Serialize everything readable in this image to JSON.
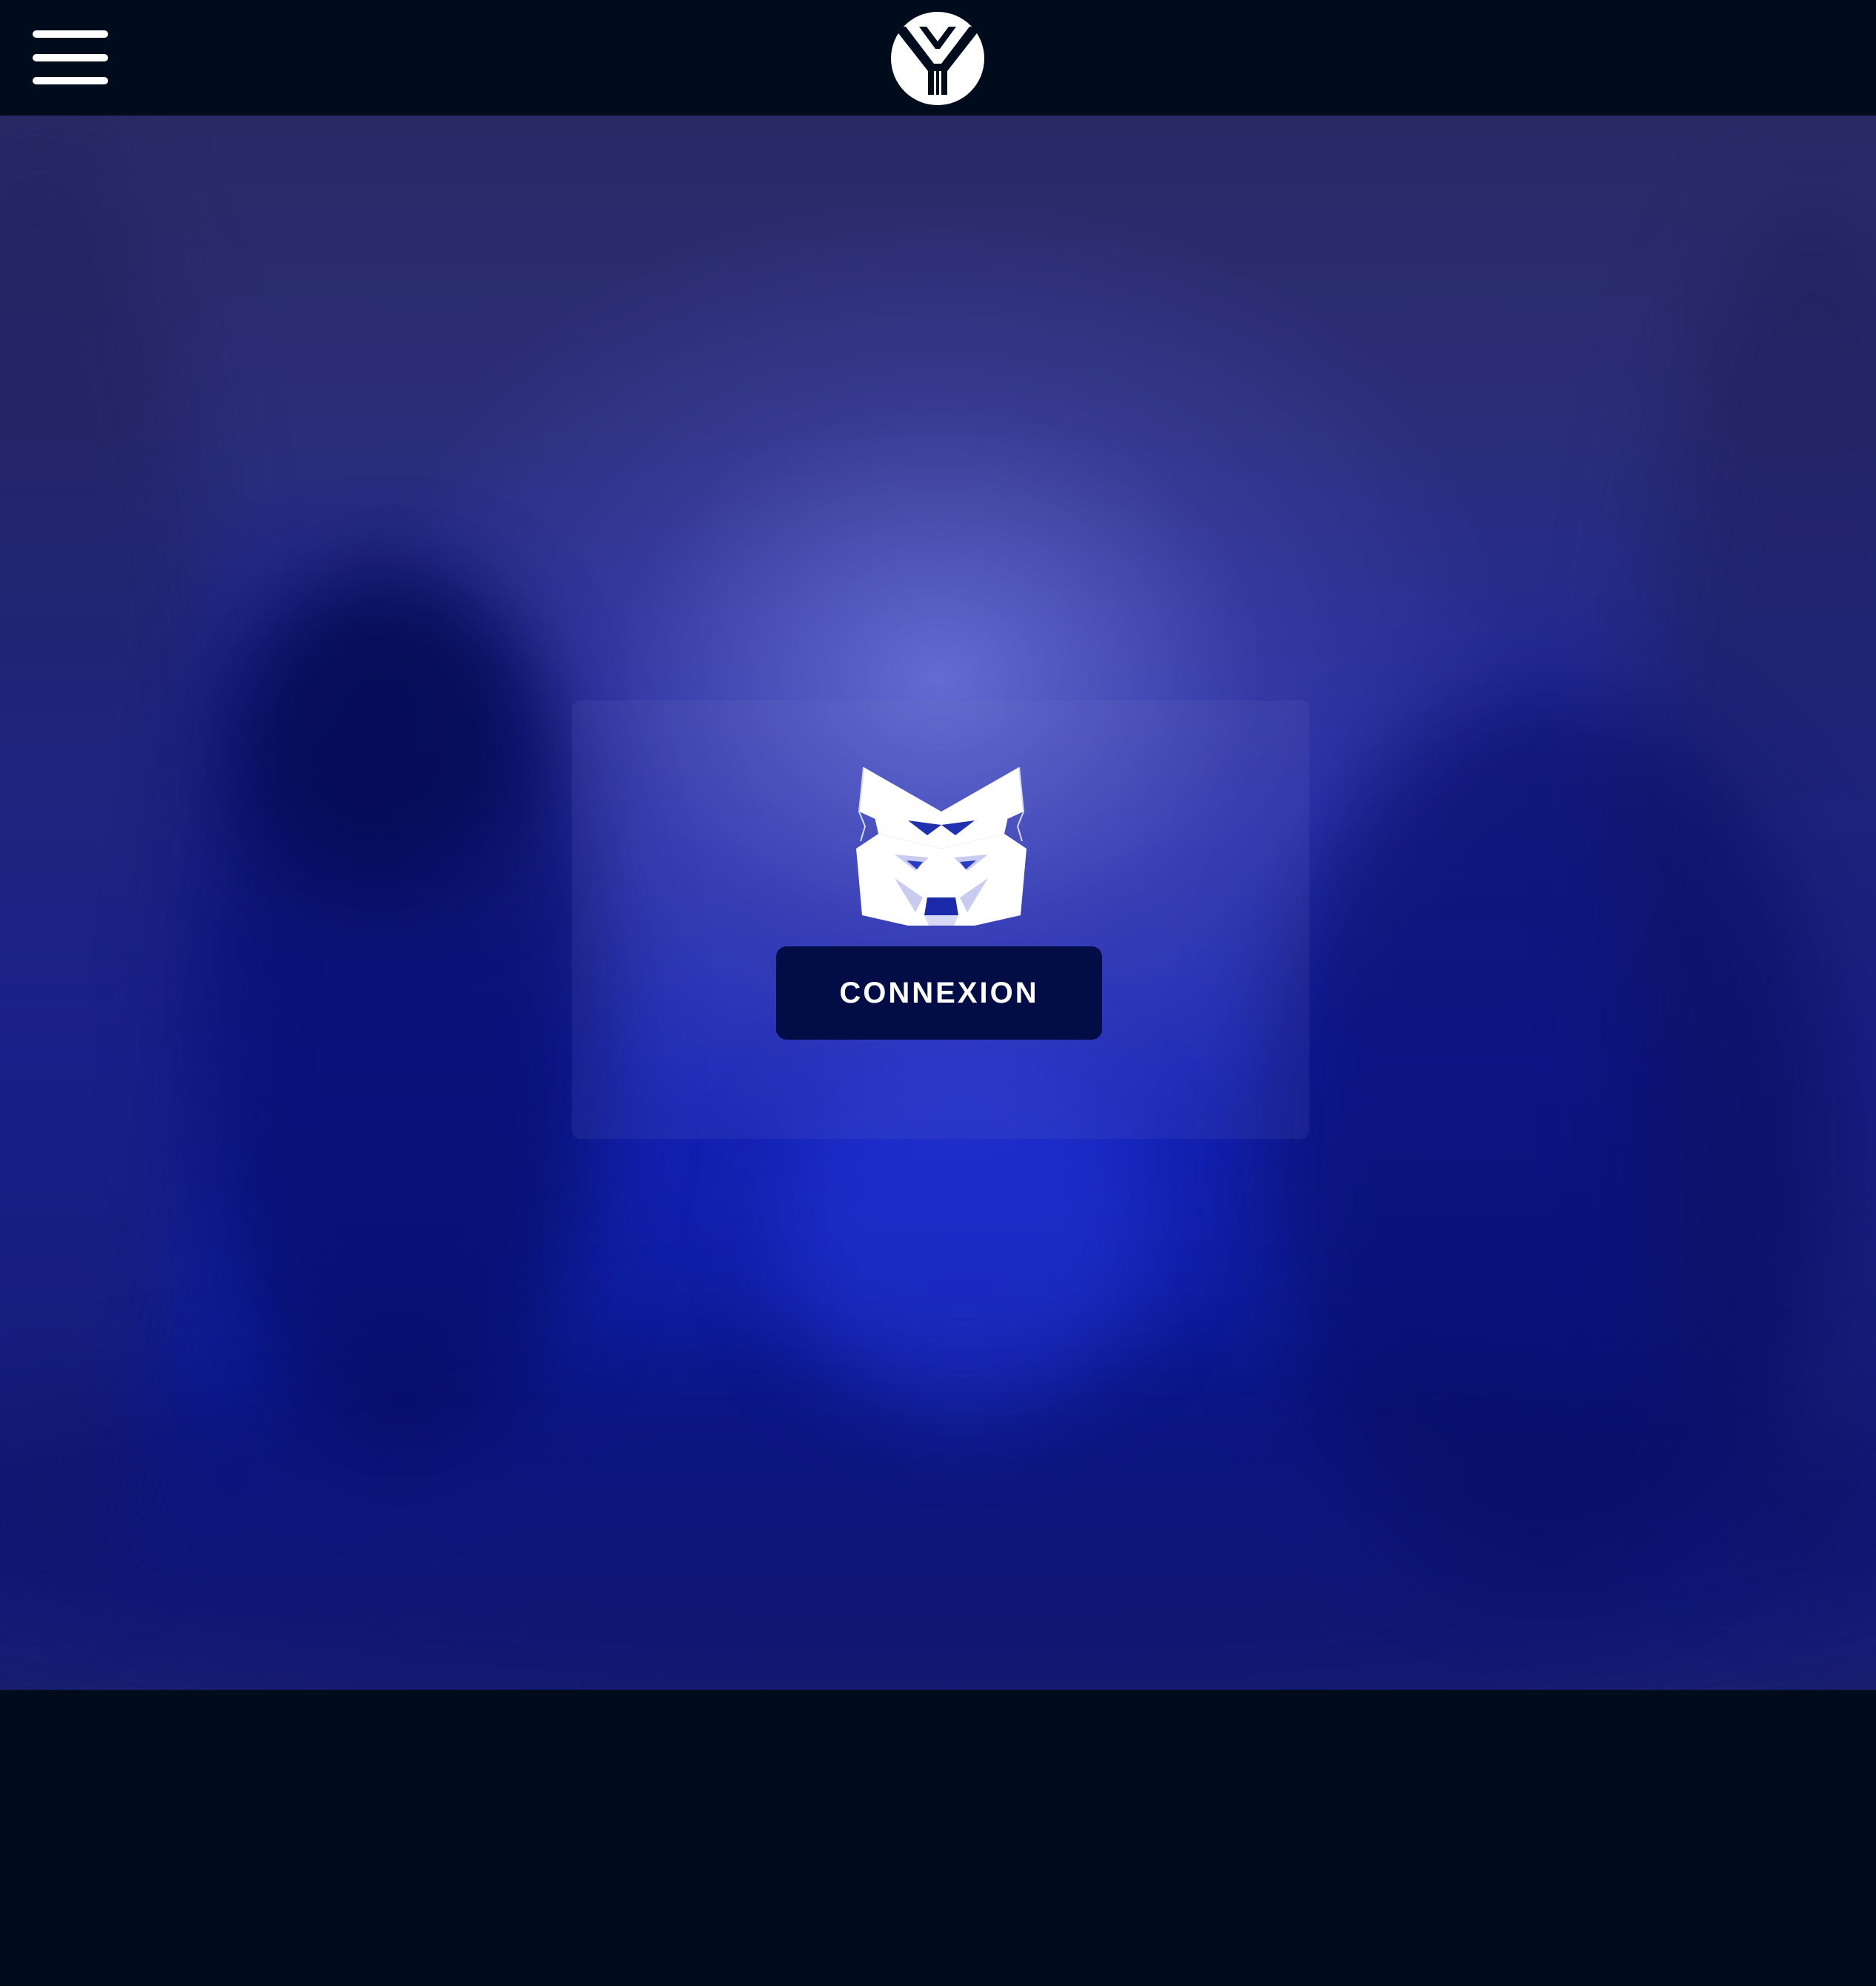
{
  "header": {
    "menu_icon": "hamburger-menu-icon",
    "logo_icon": "brand-logo-icon"
  },
  "hero": {
    "wallet_icon": "metamask-fox-icon",
    "connect_label": "CONNEXION"
  },
  "colors": {
    "header_bg": "#000b1c",
    "button_bg": "#030d45",
    "hero_accent": "#1422b8"
  }
}
